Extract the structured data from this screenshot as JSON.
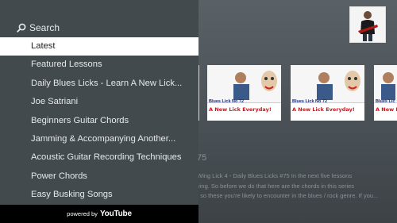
{
  "search": {
    "label": "Search"
  },
  "menu": {
    "items": [
      {
        "label": "Latest",
        "selected": true
      },
      {
        "label": "Featured Lessons"
      },
      {
        "label": "Daily Blues Licks - Learn A New Lick..."
      },
      {
        "label": "Joe Satriani"
      },
      {
        "label": "Beginners Guitar Chords"
      },
      {
        "label": "Jamming & Accompanying Another..."
      },
      {
        "label": "Acoustic Guitar Recording Techniques"
      },
      {
        "label": "Power Chords"
      },
      {
        "label": "Easy Busking Songs"
      }
    ]
  },
  "footer": {
    "powered_by": "powered by",
    "brand": "YouTube"
  },
  "thumbnails": [
    {
      "line1": "Blues Lick No 72",
      "line2": "A New Lick Everyday!"
    },
    {
      "line1": "Blues Lick No 72",
      "line2": "A New Lick Everyday!"
    },
    {
      "line1": "Blues Lic",
      "line2": "A New L"
    }
  ],
  "background_video": {
    "title_fragment": "75",
    "description": "Wing Lick 4 - Daily Blues Licks #75 In the next five lessons\nving. So before we do that here are the chords in this series\n, so these you're likely to encounter in the blues / rock genre. If you..."
  },
  "colors": {
    "panel": "#434a4e",
    "selected_bg": "#ffffff",
    "footer": "#000000",
    "thumb_title": "#1c2d7a",
    "thumb_tagline": "#d0131b"
  }
}
